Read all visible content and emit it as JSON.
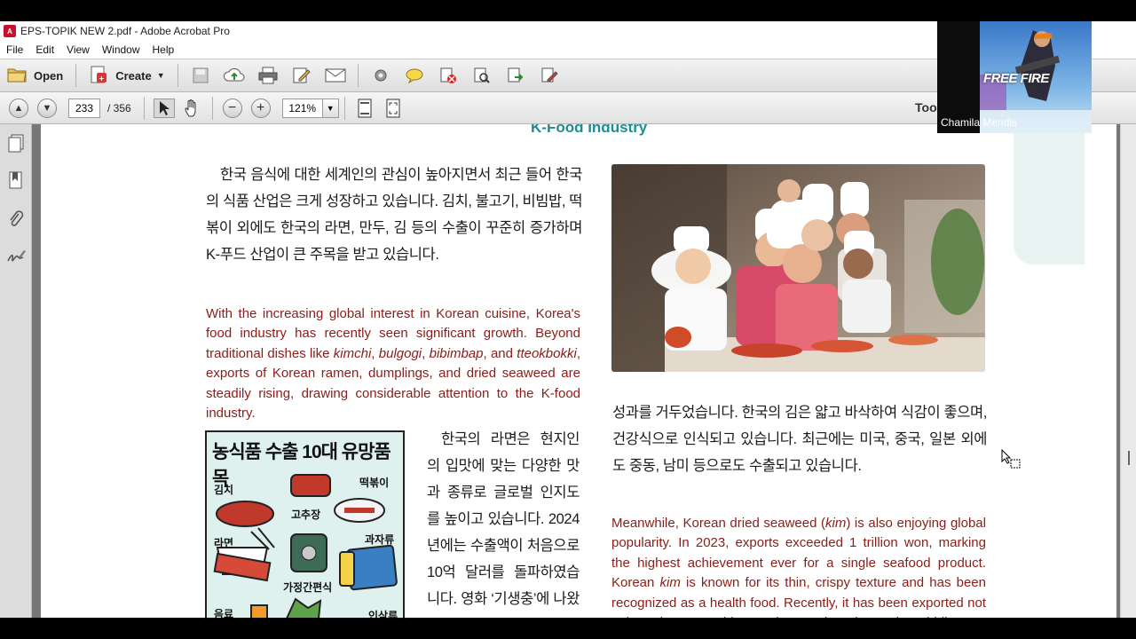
{
  "window": {
    "title": "EPS-TOPIK NEW 2.pdf - Adobe Acrobat Pro"
  },
  "menu": [
    "File",
    "Edit",
    "View",
    "Window",
    "Help"
  ],
  "toolbar": {
    "open_label": "Open",
    "create_label": "Create"
  },
  "navigation": {
    "current_page": "233",
    "total_pages": "/ 356",
    "zoom": "121%",
    "tools_label": "Too"
  },
  "document": {
    "section_title": "K-Food Industry",
    "korean_intro": "한국 음식에 대한 세계인의 관심이 높아지면서 최근 들어 한국의 식품 산업은 크게 성장하고 있습니다. 김치, 불고기, 비빔밥, 떡볶이 외에도 한국의 라면, 만두, 김 등의 수출이 꾸준히 증가하며 K-푸드 산업이 큰 주목을 받고 있습니다.",
    "english_intro_parts": [
      "With the increasing global interest in Korean cuisine, Korea's food industry has recently seen significant growth. Beyond traditional dishes like ",
      "kimchi",
      ", ",
      "bulgogi",
      ", ",
      "bibimbap",
      ", and ",
      "tteokbokki",
      ", exports of Korean ramen, dumplings, and dried seaweed are steadily rising, drawing considerable attention to the K-food industry."
    ],
    "korean_seaweed": "성과를 거두었습니다. 한국의 김은 얇고 바삭하여 식감이 좋으며, 건강식으로 인식되고 있습니다. 최근에는 미국, 중국, 일본 외에도 중동, 남미 등으로도 수출되고 있습니다.",
    "english_seaweed_parts": [
      "Meanwhile, Korean dried seaweed (",
      "kim",
      ") is also enjoying global popularity. In 2023, exports exceeded 1 trillion won, marking the highest achievement ever for a single seafood product. Korean ",
      "kim",
      " is known for its thin, crispy texture and has been recognized as a health food. Recently, it has been exported not only to the U.S., China, and Japan but also to the Middle East and South America."
    ],
    "korean_ramen": "한국의 라면은 현지인의 입맛에 맞는 다양한 맛과 종류로 글로벌 인지도를 높이고 있습니다. 2024년에는 수출액이 처음으로 10억 달러를 돌파하였습니다. 영화 ‘기생충’에 나왔던 ‘짜파구리’가",
    "poster": {
      "title": "농식품 수출 10대 유망품목",
      "labels": [
        "김치",
        "떡볶이",
        "고추장",
        "라면",
        "과자류",
        "가정간편식",
        "음료",
        "인삼류"
      ]
    }
  },
  "webcam": {
    "game_logo": "FREE FIRE",
    "participant_name": "Chamila Mendis"
  },
  "colors": {
    "accent_teal": "#1e8c93",
    "english_text": "#8a1d17",
    "poster_bg": "#dff1ee"
  }
}
